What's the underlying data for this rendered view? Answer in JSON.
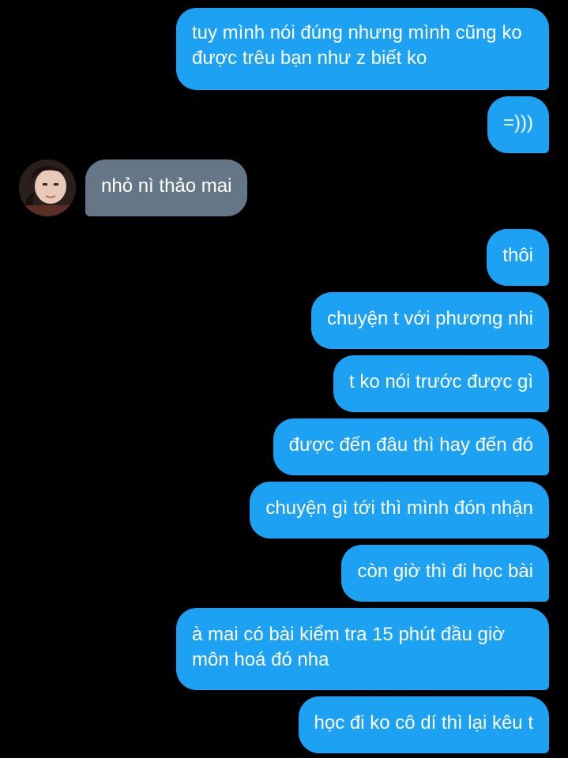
{
  "conversation": {
    "messages": [
      {
        "direction": "outgoing",
        "text": "tuy mình nói đúng nhưng mình cũng ko được trêu bạn như z biết ko"
      },
      {
        "direction": "outgoing",
        "text": "=)))"
      },
      {
        "direction": "incoming",
        "text": "nhỏ nì thảo mai"
      },
      {
        "direction": "outgoing",
        "text": "thôi"
      },
      {
        "direction": "outgoing",
        "text": "chuyện t với phương nhi"
      },
      {
        "direction": "outgoing",
        "text": "t ko nói trước được gì"
      },
      {
        "direction": "outgoing",
        "text": "được đến đâu thì hay đến đó"
      },
      {
        "direction": "outgoing",
        "text": "chuyện gì tới thì mình đón nhận"
      },
      {
        "direction": "outgoing",
        "text": "còn giờ thì đi học bài"
      },
      {
        "direction": "outgoing",
        "text": "à mai có bài kiểm tra 15 phút đầu giờ môn hoá đó nha"
      },
      {
        "direction": "outgoing",
        "text": "học đi ko cô dí thì lại kêu t"
      }
    ]
  },
  "colors": {
    "background": "#000000",
    "outgoing_bubble": "#1da1f2",
    "incoming_bubble": "#657786",
    "text": "#ffffff"
  }
}
